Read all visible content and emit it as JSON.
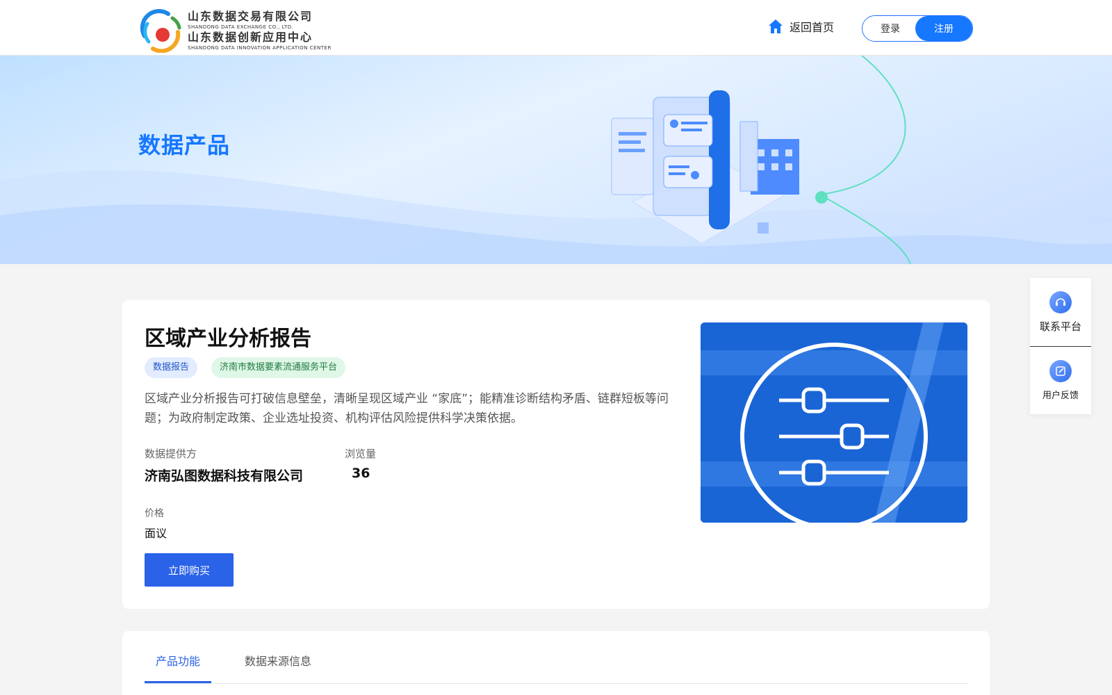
{
  "header": {
    "logo": {
      "line1_cn": "山东数据交易有限公司",
      "line1_en": "SHANDONG DATA EXCHANGE CO., LTD.",
      "line2_cn": "山东数据创新应用中心",
      "line2_en": "SHANDONG DATA INNOVATION APPLICATION CENTER"
    },
    "home_label": "返回首页",
    "login_label": "登录",
    "register_label": "注册"
  },
  "banner": {
    "title": "数据产品"
  },
  "side": {
    "contact_label": "联系平台",
    "feedback_label": "用户反馈"
  },
  "product": {
    "title": "区域产业分析报告",
    "tags": [
      "数据报告",
      "济南市数据要素流通服务平台"
    ],
    "description": "区域产业分析报告可打破信息壁垒，清晰呈现区域产业 “家底”；能精准诊断结构矛盾、链群短板等问题；为政府制定政策、企业选址投资、机构评估风险提供科学决策依据。",
    "provider_label": "数据提供方",
    "provider_value": "济南弘图数据科技有限公司",
    "views_label": "浏览量",
    "views_value": "36",
    "price_label": "价格",
    "price_value": "面议",
    "buy_label": "立即购买"
  },
  "tabs": {
    "items": [
      "产品功能",
      "数据来源信息"
    ],
    "active": 0
  },
  "colors": {
    "primary": "#1677ff",
    "button": "#2a62e8",
    "tag_blue_bg": "#e3ecff",
    "tag_green_bg": "#dff7e7"
  }
}
